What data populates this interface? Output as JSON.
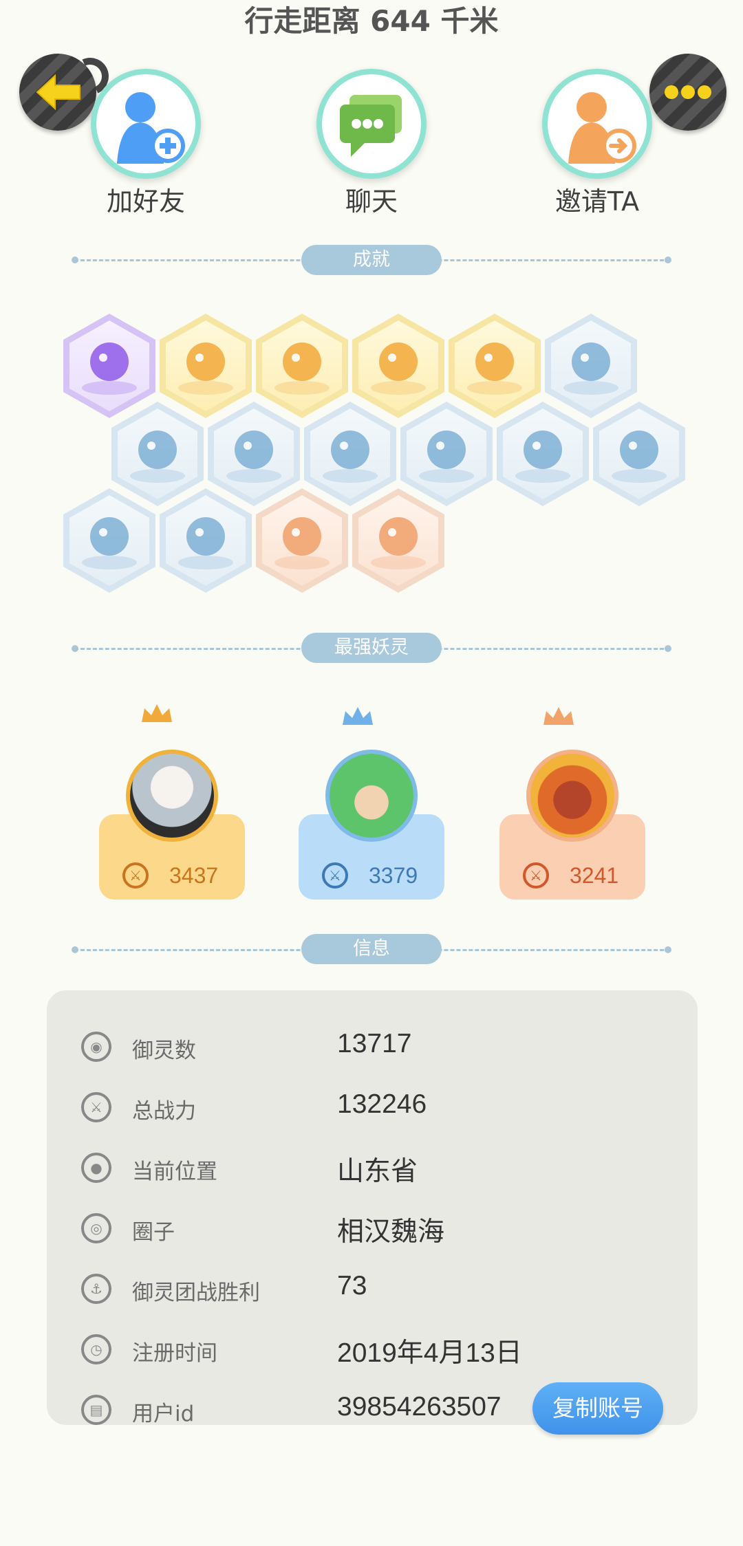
{
  "header": {
    "title": "行走距离 644 千米"
  },
  "nav": {
    "back_icon": "arrow-left-icon",
    "more_icon": "more-dots-icon"
  },
  "actions": [
    {
      "label": "加好友",
      "icon": "add-friend-icon"
    },
    {
      "label": "聊天",
      "icon": "chat-icon"
    },
    {
      "label": "邀请TA",
      "icon": "invite-icon"
    }
  ],
  "sections": {
    "achievements": "成就",
    "strongest": "最强妖灵",
    "info": "信息"
  },
  "achievements": [
    {
      "icon": "purple-cat-badge-icon",
      "tone": "purple"
    },
    {
      "icon": "gold-orb-badge-icon",
      "tone": "gold"
    },
    {
      "icon": "gold-yinyang-swirl-badge-icon",
      "tone": "gold"
    },
    {
      "icon": "gold-yinyang-book-badge-icon",
      "tone": "gold"
    },
    {
      "icon": "gold-fox-badge-icon",
      "tone": "gold"
    },
    {
      "icon": "sneaker-badge-icon",
      "tone": "blue"
    },
    {
      "icon": "radar-badge-icon",
      "tone": "blue"
    },
    {
      "icon": "moon-badge-icon",
      "tone": "blue"
    },
    {
      "icon": "crystal-badge-icon",
      "tone": "blue"
    },
    {
      "icon": "spirit-statue-badge-icon",
      "tone": "blue"
    },
    {
      "icon": "cat-cart-badge-icon",
      "tone": "blue"
    },
    {
      "icon": "cat-balloon-badge-icon",
      "tone": "blue"
    },
    {
      "icon": "shield-badge-icon",
      "tone": "blue"
    },
    {
      "icon": "cat-silhouette-badge-icon",
      "tone": "blue"
    },
    {
      "icon": "dragon-koi-badge-icon",
      "tone": "orange"
    },
    {
      "icon": "ox-statue-badge-icon",
      "tone": "orange"
    }
  ],
  "top_spirits": [
    {
      "power": "3437",
      "crown_color": "#f2a93b",
      "card_color": "#fcd98a",
      "ring_color": "#f0b23a",
      "text_color": "#c9751e"
    },
    {
      "power": "3379",
      "crown_color": "#6fb1e8",
      "card_color": "#b9dcf8",
      "ring_color": "#7fbbe9",
      "text_color": "#3c79b5"
    },
    {
      "power": "3241",
      "crown_color": "#f1a36a",
      "card_color": "#fbcfb1",
      "ring_color": "#f4b086",
      "text_color": "#d0582a"
    }
  ],
  "info": [
    {
      "label": "御灵数",
      "value": "13717",
      "icon": "spirit-count-icon"
    },
    {
      "label": "总战力",
      "value": "132246",
      "icon": "sword-power-icon"
    },
    {
      "label": "当前位置",
      "value": "山东省",
      "icon": "location-pin-icon"
    },
    {
      "label": "圈子",
      "value": "相汉魏海",
      "icon": "circle-group-icon"
    },
    {
      "label": "御灵团战胜利",
      "value": "73",
      "icon": "team-battle-icon"
    },
    {
      "label": "注册时间",
      "value": "2019年4月13日",
      "icon": "clock-icon"
    },
    {
      "label": "用户id",
      "value": "39854263507",
      "icon": "user-id-icon"
    }
  ],
  "copy_button": "复制账号"
}
